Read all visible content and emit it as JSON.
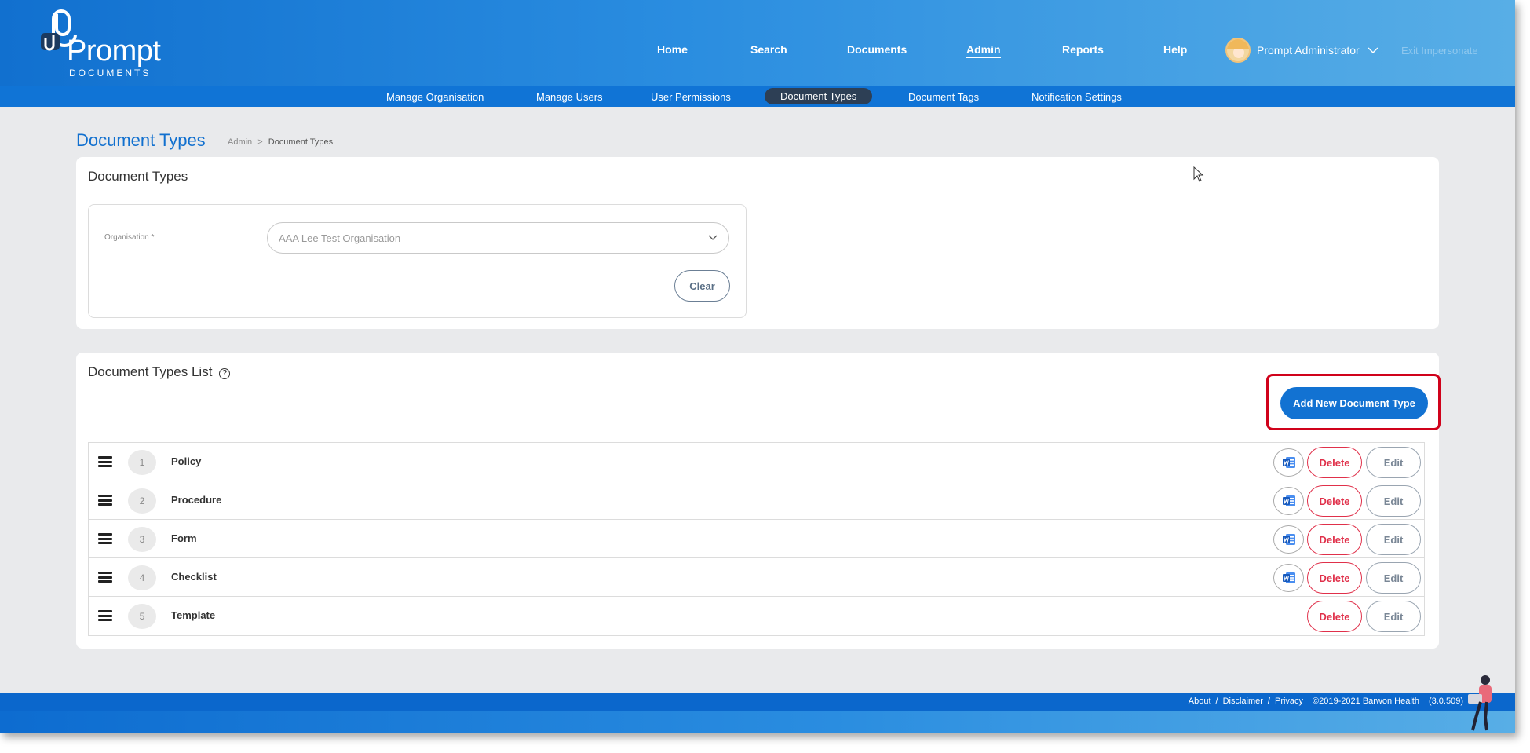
{
  "brand": {
    "name": "Prompt",
    "sub": "DOCUMENTS"
  },
  "nav": {
    "items": [
      {
        "label": "Home"
      },
      {
        "label": "Search"
      },
      {
        "label": "Documents"
      },
      {
        "label": "Admin",
        "active": true
      },
      {
        "label": "Reports"
      },
      {
        "label": "Help"
      }
    ],
    "user": "Prompt Administrator",
    "exit": "Exit Impersonate"
  },
  "subnav": {
    "items": [
      {
        "label": "Manage Organisation"
      },
      {
        "label": "Manage Users"
      },
      {
        "label": "User Permissions"
      },
      {
        "label": "Document Types",
        "active": true
      },
      {
        "label": "Document Tags"
      },
      {
        "label": "Notification Settings"
      }
    ]
  },
  "page": {
    "title": "Document Types",
    "breadcrumb": {
      "parent": "Admin",
      "separator": ">",
      "current": "Document Types"
    }
  },
  "filter": {
    "card_title": "Document Types",
    "org_label": "Organisation *",
    "org_value": "AAA Lee Test Organisation",
    "clear_label": "Clear"
  },
  "list": {
    "title": "Document Types List",
    "help_glyph": "?",
    "add_label": "Add New Document Type",
    "delete_label": "Delete",
    "edit_label": "Edit",
    "rows": [
      {
        "num": "1",
        "name": "Policy",
        "word": true
      },
      {
        "num": "2",
        "name": "Procedure",
        "word": true
      },
      {
        "num": "3",
        "name": "Form",
        "word": true
      },
      {
        "num": "4",
        "name": "Checklist",
        "word": true
      },
      {
        "num": "5",
        "name": "Template",
        "word": false
      }
    ]
  },
  "footer": {
    "about": "About",
    "sep": "/",
    "disclaimer": "Disclaimer",
    "privacy": "Privacy",
    "copyright": "©2019-2021 Barwon Health",
    "version": "(3.0.509)"
  },
  "colors": {
    "primary": "#1170cf",
    "danger": "#e0304a",
    "highlight": "#d0021b"
  }
}
